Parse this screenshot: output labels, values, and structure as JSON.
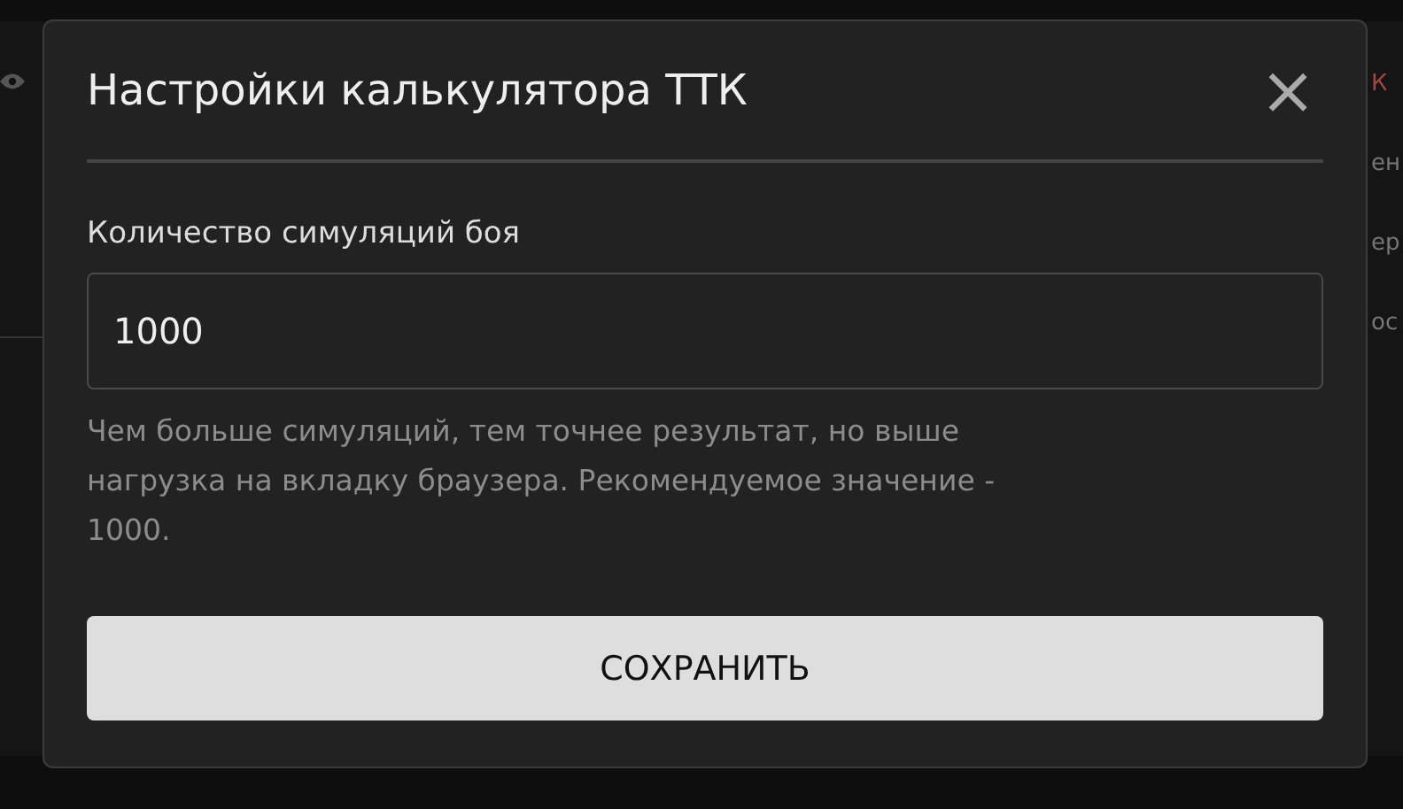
{
  "background": {
    "fragments": [
      {
        "text": "К",
        "kind": "accent"
      },
      {
        "text": "ен",
        "kind": "muted"
      },
      {
        "text": "ер",
        "kind": "muted"
      },
      {
        "text": "ос",
        "kind": "muted"
      }
    ]
  },
  "dialog": {
    "title": "Настройки калькулятора ТТК",
    "close": "×",
    "field": {
      "label": "Количество симуляций боя",
      "value": "1000",
      "help": "Чем больше симуляций, тем точнее результат, но выше нагрузка на вкладку браузера. Рекомендуемое значение - 1000."
    },
    "button": "СОХРАНИТЬ"
  }
}
